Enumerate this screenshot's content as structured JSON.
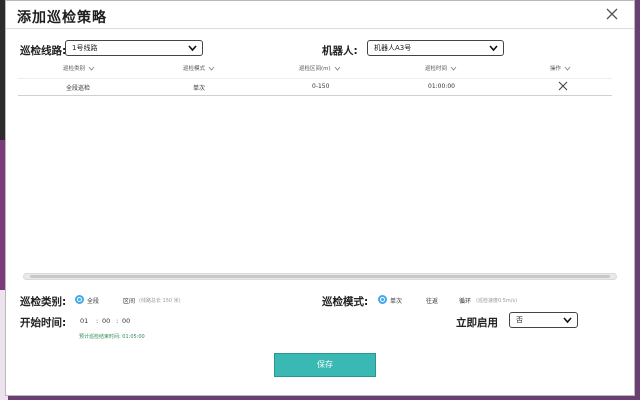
{
  "dialog": {
    "title": "添加巡检策略"
  },
  "route": {
    "label": "巡检线路:",
    "value": "1号线路"
  },
  "robot": {
    "label": "机器人:",
    "value": "机器人A3号"
  },
  "table": {
    "columns": [
      "巡检类别",
      "巡检模式",
      "巡检区间(m)",
      "巡检时间",
      "操作"
    ],
    "rows": [
      {
        "category": "全段巡检",
        "mode": "单次",
        "interval": "0-150",
        "time": "01:00:00"
      }
    ]
  },
  "form": {
    "category": {
      "label": "巡检类别:",
      "options": [
        "全段",
        "区间"
      ],
      "selected": "全段",
      "section_hint": "(线路总长 150 米)"
    },
    "mode": {
      "label": "巡检模式:",
      "options": [
        "单次",
        "往返",
        "循环"
      ],
      "selected": "单次",
      "loop_hint": "(巡检速度0.5m/s)"
    },
    "start_time": {
      "label": "开始时间:",
      "hour": "01",
      "minute": "00",
      "second": "00",
      "estimated": "预计巡检结束时间: 01:05:00"
    },
    "enable_now": {
      "label": "立即启用",
      "value": "否"
    }
  },
  "save_label": "保存",
  "colors": {
    "accent": "#3ab8b3",
    "radio": "#43a7e8",
    "estimate": "#2e8b57"
  }
}
